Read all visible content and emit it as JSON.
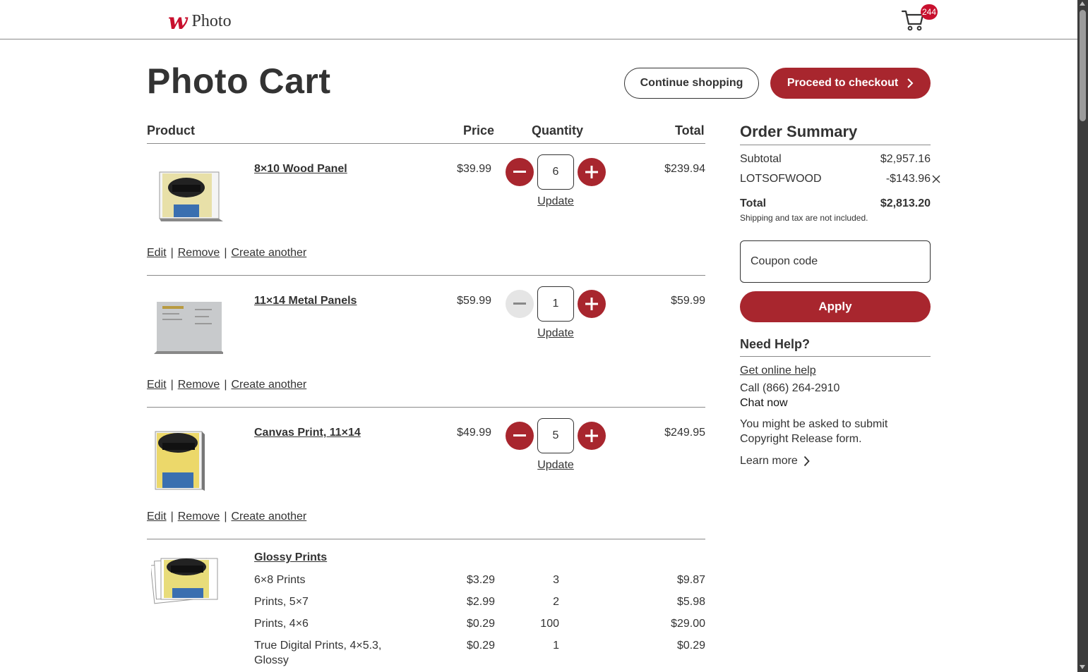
{
  "header": {
    "logo_mark": "w",
    "logo_text": "Photo",
    "cart_count": "244"
  },
  "page": {
    "title": "Photo Cart",
    "continue_label": "Continue shopping",
    "checkout_label": "Proceed to checkout"
  },
  "columns": {
    "product": "Product",
    "price": "Price",
    "quantity": "Quantity",
    "total": "Total"
  },
  "items": [
    {
      "name": "8×10 Wood Panel",
      "price": "$39.99",
      "quantity": "6",
      "total": "$239.94",
      "update": "Update",
      "decrement_enabled": true
    },
    {
      "name": "11×14 Metal Panels",
      "price": "$59.99",
      "quantity": "1",
      "total": "$59.99",
      "update": "Update",
      "decrement_enabled": false
    },
    {
      "name": "Canvas Print, 11×14",
      "price": "$49.99",
      "quantity": "5",
      "total": "$249.95",
      "update": "Update",
      "decrement_enabled": true
    }
  ],
  "item_actions": {
    "edit": "Edit",
    "remove": "Remove",
    "create_another": "Create another",
    "separator": "|"
  },
  "prints_group": {
    "name": "Glossy Prints",
    "rows": [
      {
        "name": "6×8 Prints",
        "price": "$3.29",
        "quantity": "3",
        "total": "$9.87"
      },
      {
        "name": "Prints, 5×7",
        "price": "$2.99",
        "quantity": "2",
        "total": "$5.98"
      },
      {
        "name": "Prints, 4×6",
        "price": "$0.29",
        "quantity": "100",
        "total": "$29.00"
      },
      {
        "name_line1": "True Digital Prints, 4×5.3,",
        "name_line2": "Glossy",
        "price": "$0.29",
        "quantity": "1",
        "total": "$0.29"
      }
    ]
  },
  "summary": {
    "title": "Order Summary",
    "subtotal_label": "Subtotal",
    "subtotal_value": "$2,957.16",
    "coupon_code": "LOTSOFWOOD",
    "coupon_value": "-$143.96",
    "total_label": "Total",
    "total_value": "$2,813.20",
    "note": "Shipping and tax are not included.",
    "coupon_placeholder": "Coupon code",
    "apply_label": "Apply"
  },
  "help": {
    "title": "Need Help?",
    "online_help": "Get online help",
    "call": "Call (866) 264-2910",
    "chat": "Chat now",
    "copyright_line1": "You might be asked to submit",
    "copyright_line2": "Copyright Release form.",
    "learn_more": "Learn more"
  },
  "colors": {
    "brand": "#a8262e",
    "badge": "#c8102e"
  }
}
